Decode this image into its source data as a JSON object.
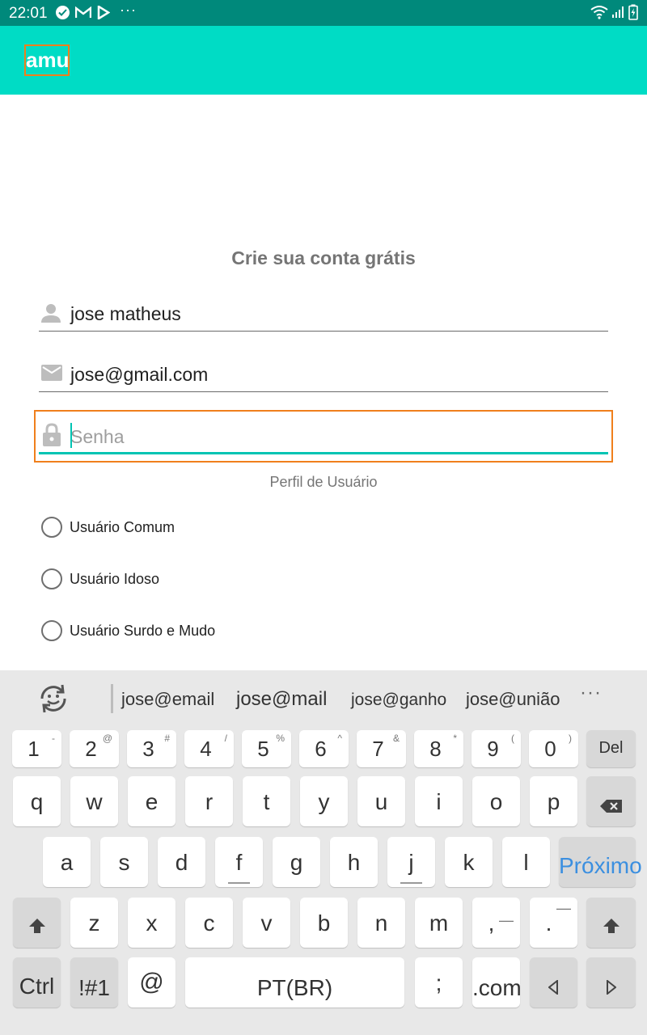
{
  "status_bar": {
    "time": "22:01",
    "more": "···"
  },
  "app_bar": {
    "title": "amu"
  },
  "form": {
    "heading": "Crie sua conta grátis",
    "name_value": "jose matheus",
    "email_value": "jose@gmail.com",
    "password_placeholder": "Senha",
    "profile_label": "Perfil de Usuário",
    "radio_options": [
      "Usuário Comum",
      "Usuário Idoso",
      "Usuário Surdo e Mudo"
    ]
  },
  "keyboard": {
    "suggestions": [
      "jose@email",
      "jose@mail",
      "jose@ganho",
      "jose@união"
    ],
    "suggestions_more": "···",
    "number_row": [
      {
        "main": "1",
        "sup": "-"
      },
      {
        "main": "2",
        "sup": "@"
      },
      {
        "main": "3",
        "sup": "#"
      },
      {
        "main": "4",
        "sup": "/"
      },
      {
        "main": "5",
        "sup": "%"
      },
      {
        "main": "6",
        "sup": "^"
      },
      {
        "main": "7",
        "sup": "&"
      },
      {
        "main": "8",
        "sup": "*"
      },
      {
        "main": "9",
        "sup": "("
      },
      {
        "main": "0",
        "sup": ")"
      }
    ],
    "del_label": "Del",
    "row1": [
      "q",
      "w",
      "e",
      "r",
      "t",
      "y",
      "u",
      "i",
      "o",
      "p"
    ],
    "row2": [
      "a",
      "s",
      "d",
      "f",
      "g",
      "h",
      "j",
      "k",
      "l"
    ],
    "next_label": "Próximo",
    "row3": [
      "z",
      "x",
      "c",
      "v",
      "b",
      "n",
      "m"
    ],
    "comma_key": {
      "main": ",",
      "sup": "—"
    },
    "period_key": {
      "main": ".",
      "sup": "—"
    },
    "ctrl_label": "Ctrl",
    "symbols_label": "!#1",
    "at_label": "@",
    "space_label": "PT(BR)",
    "semicolon_label": ";",
    "dotcom_label": ".com"
  }
}
